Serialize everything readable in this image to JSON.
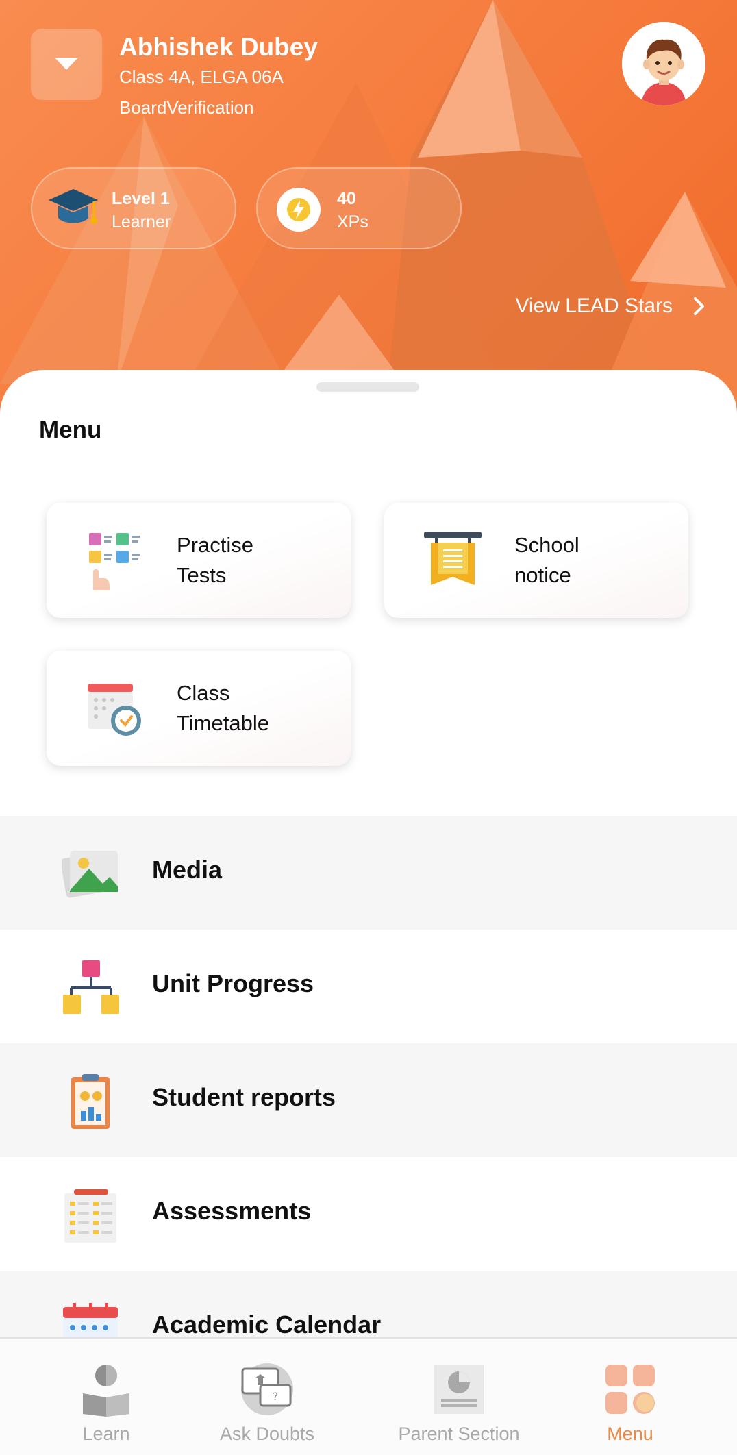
{
  "header": {
    "user_name": "Abhishek Dubey",
    "class_info": "Class 4A, ELGA 06A",
    "board": "BoardVerification",
    "level": {
      "title": "Level 1",
      "subtitle": "Learner",
      "icon": "graduation-cap-icon"
    },
    "xp": {
      "value": "40",
      "unit": "XPs",
      "icon": "lightning-icon"
    },
    "lead_stars_link": "View LEAD Stars",
    "colors": {
      "gradient_start": "#f98c50",
      "gradient_end": "#f06a2a"
    }
  },
  "menu": {
    "title": "Menu",
    "cards": [
      {
        "line1": "Practise",
        "line2": "Tests",
        "icon": "quiz-cards-icon"
      },
      {
        "line1": "School",
        "line2": "notice",
        "icon": "notice-board-icon"
      },
      {
        "line1": "Class",
        "line2": "Timetable",
        "icon": "calendar-clock-icon"
      }
    ],
    "rows": [
      {
        "label": "Media",
        "icon": "image-gallery-icon"
      },
      {
        "label": "Unit Progress",
        "icon": "hierarchy-icon"
      },
      {
        "label": "Student reports",
        "icon": "report-clipboard-icon"
      },
      {
        "label": "Assessments",
        "icon": "assessment-sheet-icon"
      },
      {
        "label": "Academic Calendar",
        "icon": "calendar-icon"
      }
    ]
  },
  "bottom_nav": {
    "items": [
      {
        "label": "Learn",
        "icon": "reader-icon"
      },
      {
        "label": "Ask Doubts",
        "icon": "doubt-chat-icon"
      },
      {
        "label": "Parent Section",
        "icon": "pie-report-icon"
      },
      {
        "label": "Menu",
        "icon": "menu-grid-icon"
      }
    ],
    "active": "Menu",
    "active_color": "#e58a47"
  }
}
